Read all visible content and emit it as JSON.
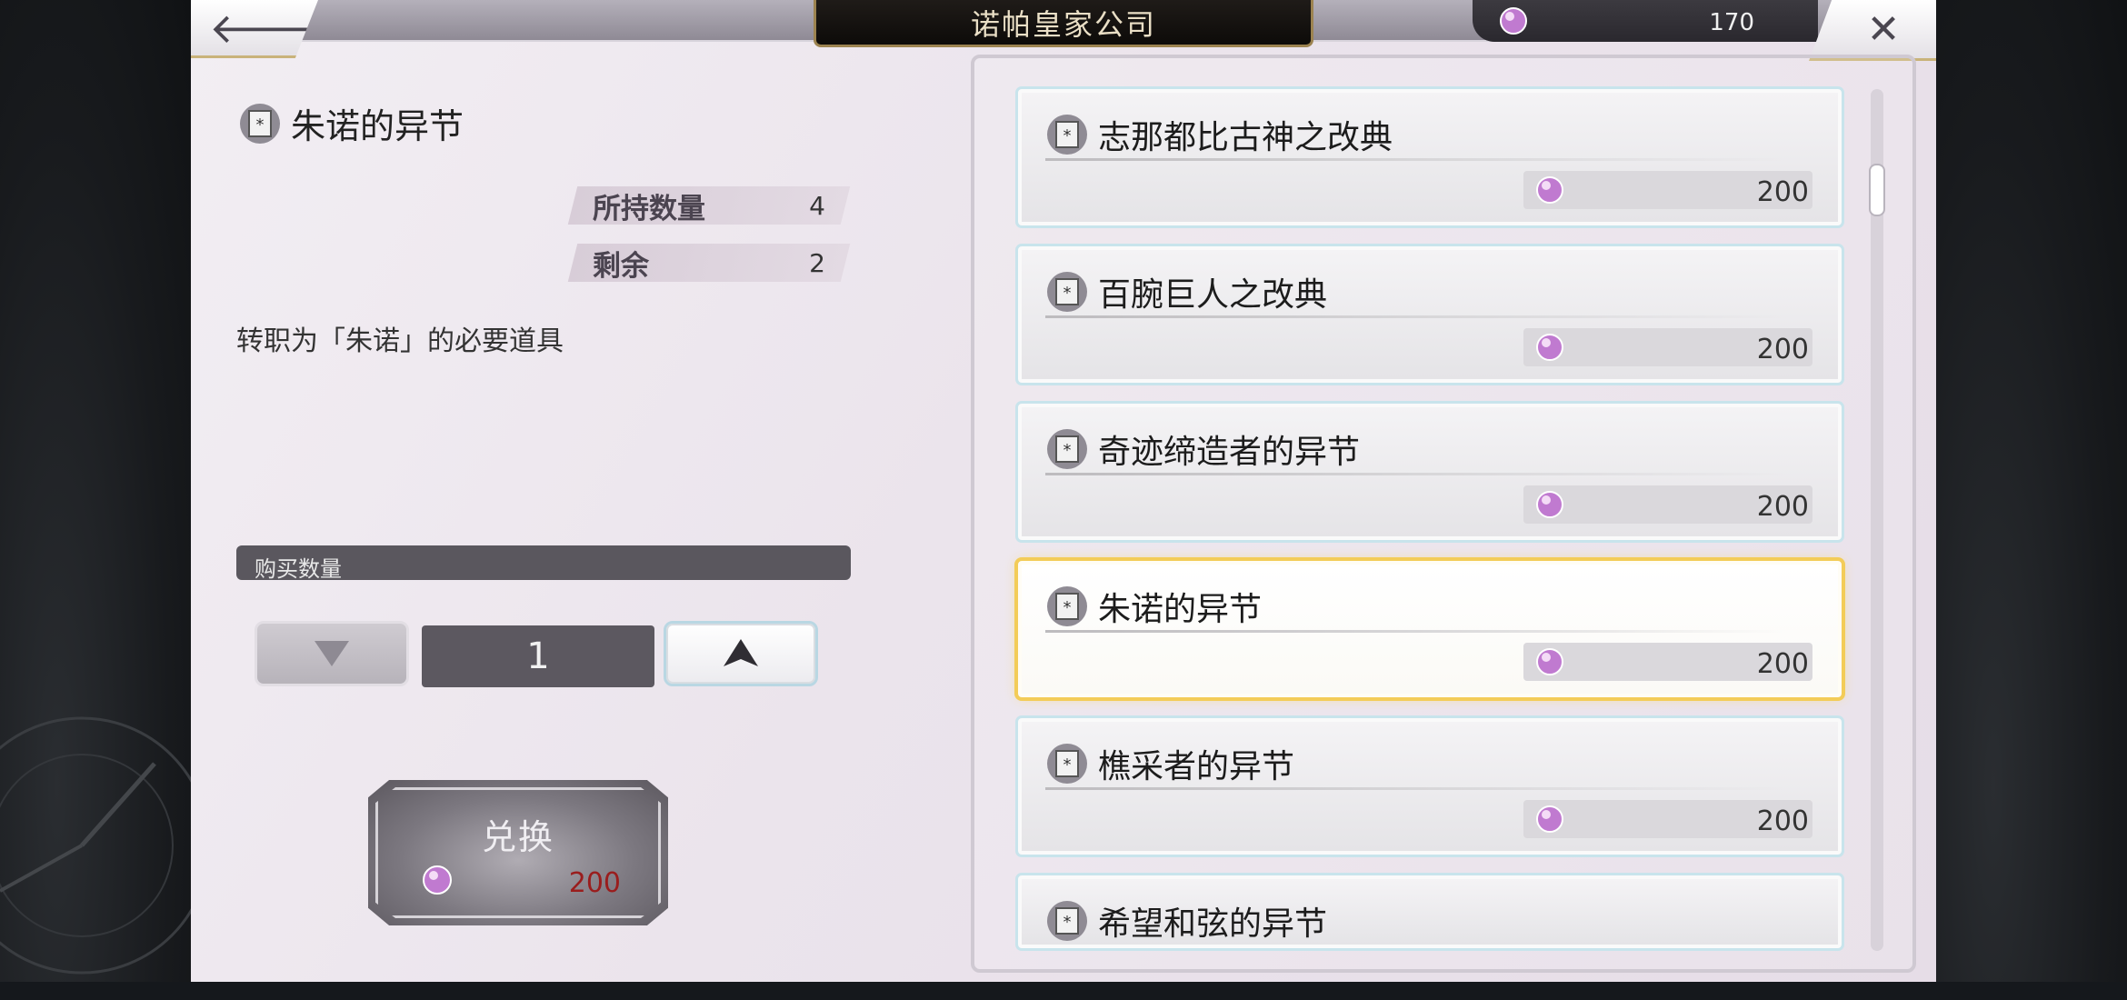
{
  "header": {
    "back_symbol": "🡐",
    "title": "诺帕皇家公司",
    "currency_amount": "170",
    "close_symbol": "✕"
  },
  "detail": {
    "name": "朱诺的异节",
    "owned_label": "所持数量",
    "owned_value": "4",
    "remain_label": "剩余",
    "remain_value": "2",
    "description": "转职为「朱诺」的必要道具",
    "qty_label": "购买数量",
    "quantity": "1",
    "exchange_label": "兑换",
    "exchange_price": "200"
  },
  "items": [
    {
      "name": "志那都比古神之改典",
      "price": "200"
    },
    {
      "name": "百腕巨人之改典",
      "price": "200"
    },
    {
      "name": "奇迹缔造者的异节",
      "price": "200"
    },
    {
      "name": "朱诺的异节",
      "price": "200"
    },
    {
      "name": "樵采者的异节",
      "price": "200"
    },
    {
      "name": "希望和弦的异节",
      "price": ""
    }
  ],
  "colors": {
    "selected_outline": "#f3cc58",
    "price_red": "#9a1d1d",
    "gem": "#c07ad0"
  }
}
